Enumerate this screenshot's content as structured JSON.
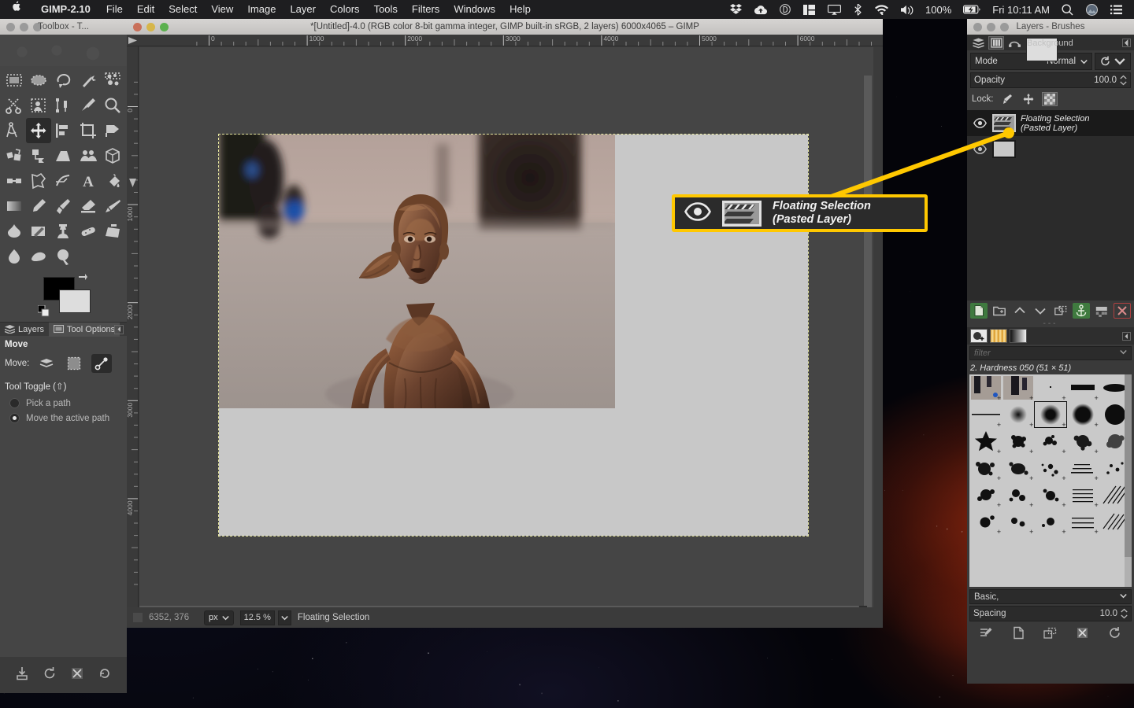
{
  "menubar": {
    "apple_icon": "apple-icon",
    "app_name": "GIMP-2.10",
    "menus": [
      "File",
      "Edit",
      "Select",
      "View",
      "Image",
      "Layer",
      "Colors",
      "Tools",
      "Filters",
      "Windows",
      "Help"
    ],
    "status_icons": [
      "dropbox-icon",
      "cloud-upload-icon",
      "d-circle-icon",
      "grid-panel-icon",
      "airplay-icon",
      "bluetooth-icon",
      "wifi-icon",
      "volume-icon"
    ],
    "battery_percent": "100%",
    "battery_icon": "battery-charging-icon",
    "clock": "Fri 10:11 AM",
    "search_icon": "search-icon",
    "user_icon": "user-avatar-icon",
    "control_center_icon": "list-menu-icon"
  },
  "toolbox": {
    "title": "Toolbox - T...",
    "tools": [
      {
        "name": "rect-select-tool"
      },
      {
        "name": "ellipse-select-tool"
      },
      {
        "name": "free-select-tool"
      },
      {
        "name": "fuzzy-select-tool"
      },
      {
        "name": "select-by-color-tool"
      },
      {
        "name": "scissors-select-tool"
      },
      {
        "name": "foreground-select-tool"
      },
      {
        "name": "paths-tool"
      },
      {
        "name": "color-picker-tool"
      },
      {
        "name": "zoom-tool"
      },
      {
        "name": "measure-tool"
      },
      {
        "name": "move-tool"
      },
      {
        "name": "alignment-tool"
      },
      {
        "name": "crop-tool"
      },
      {
        "name": "rotate-tool"
      },
      {
        "name": "scale-tool"
      },
      {
        "name": "shear-tool"
      },
      {
        "name": "perspective-tool"
      },
      {
        "name": "unified-transform-tool"
      },
      {
        "name": "handle-transform-tool"
      },
      {
        "name": "flip-tool"
      },
      {
        "name": "cage-transform-tool"
      },
      {
        "name": "warp-transform-tool"
      },
      {
        "name": "text-tool"
      },
      {
        "name": "bucket-fill-tool"
      },
      {
        "name": "gradient-tool"
      },
      {
        "name": "pencil-tool"
      },
      {
        "name": "paintbrush-tool"
      },
      {
        "name": "eraser-tool"
      },
      {
        "name": "airbrush-tool"
      },
      {
        "name": "ink-tool"
      },
      {
        "name": "mypaint-brush-tool"
      },
      {
        "name": "clone-tool"
      },
      {
        "name": "heal-tool"
      },
      {
        "name": "perspective-clone-tool"
      },
      {
        "name": "blur-sharpen-tool"
      },
      {
        "name": "smudge-tool"
      },
      {
        "name": "dodge-burn-tool"
      }
    ],
    "selected_tool": "move-tool",
    "foreground_color": "#000000",
    "background_color": "#dddddd"
  },
  "dock_tabs": {
    "layers_label": "Layers",
    "tool_options_label": "Tool Options",
    "active": "Tool Options"
  },
  "tool_options": {
    "heading": "Move",
    "move_label": "Move:",
    "move_modes": [
      "move-layer-icon",
      "move-selection-icon",
      "move-path-icon"
    ],
    "selected_move_mode": "move-path-icon",
    "tool_toggle_label": "Tool Toggle  (⇧)",
    "options": [
      {
        "label": "Pick a path",
        "selected": false
      },
      {
        "label": "Move the active path",
        "selected": true
      }
    ]
  },
  "toolbox_footer_icons": [
    "save-tool-options-icon",
    "restore-tool-options-icon",
    "delete-tool-options-icon",
    "reset-tool-options-icon"
  ],
  "image_window": {
    "title": "*[Untitled]-4.0 (RGB color 8-bit gamma integer, GIMP built-in sRGB, 2 layers) 6000x4065 – GIMP",
    "ruler_h_labels": [
      "0",
      "1000",
      "2000",
      "3000",
      "4000",
      "5000",
      "6000"
    ],
    "ruler_v_labels": [
      "0",
      "1000",
      "2000",
      "3000",
      "4000"
    ],
    "statusbar": {
      "coordinates": "6352, 376",
      "unit": "px",
      "zoom": "12.5 %",
      "message": "Floating Selection"
    }
  },
  "dock": {
    "title": "Layers - Brushes",
    "tabs": [
      "layers-tab-icon",
      "channels-tab-icon",
      "paths-tab-icon",
      "undo-history-tab-icon"
    ],
    "active_tab": "channels-tab-icon",
    "mode_label": "Mode",
    "mode_value": "Normal",
    "opacity_label": "Opacity",
    "opacity_value": "100.0",
    "lock_label": "Lock:",
    "lock_buttons": [
      "lock-pixels-icon",
      "lock-position-icon",
      "lock-alpha-icon"
    ],
    "lock_active": "lock-alpha-icon",
    "layers": [
      {
        "name_line1": "Floating Selection",
        "name_line2": "(Pasted Layer)",
        "visible": true,
        "selected": true
      },
      {
        "name_line1": "Background",
        "name_line2": "",
        "visible": true,
        "selected": false
      }
    ],
    "layer_buttons": [
      "new-layer-icon",
      "new-layer-group-icon",
      "raise-layer-icon",
      "lower-layer-icon",
      "duplicate-layer-icon",
      "anchor-layer-icon",
      "merge-down-icon",
      "delete-layer-icon"
    ],
    "brush_tabs": [
      "brushes-tab-icon",
      "patterns-tab-icon",
      "gradients-tab-icon"
    ],
    "filter_placeholder": "filter",
    "selected_brush": "2. Hardness 050 (51 × 51)",
    "basic_label": "Basic,",
    "spacing_label": "Spacing",
    "spacing_value": "10.0",
    "brush_footer_icons": [
      "edit-brush-icon",
      "new-brush-icon",
      "duplicate-brush-icon",
      "delete-brush-icon",
      "refresh-brushes-icon"
    ]
  },
  "annotation": {
    "highlight_color": "#ffc800",
    "callout_line1": "Floating Selection",
    "callout_line2": "(Pasted Layer)",
    "eye_icon": "eye-visibility-icon",
    "thumbnail_icon": "layer-thumbnail-icon"
  }
}
